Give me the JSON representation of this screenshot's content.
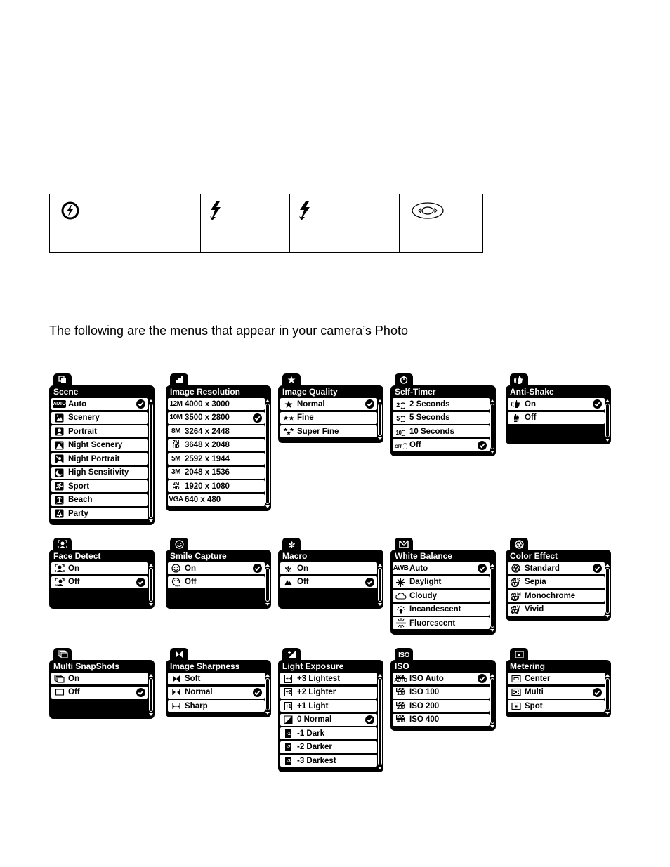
{
  "flash_table": {
    "icons": [
      "flash-off-icon",
      "flash-auto-icon",
      "flash-forced-icon",
      "left-right-nav-icon"
    ]
  },
  "intro_text": "The following are the menus that appear in your camera’s Photo",
  "menus": [
    {
      "title": "Scene",
      "tab_icon": "scene-icon",
      "items": [
        {
          "label": "Auto",
          "icon": "auto-icon",
          "selected": true
        },
        {
          "label": "Scenery",
          "icon": "scenery-icon"
        },
        {
          "label": "Portrait",
          "icon": "portrait-icon"
        },
        {
          "label": "Night Scenery",
          "icon": "night-scenery-icon"
        },
        {
          "label": "Night Portrait",
          "icon": "night-portrait-icon"
        },
        {
          "label": "High Sensitivity",
          "icon": "high-sensitivity-icon"
        },
        {
          "label": "Sport",
          "icon": "sport-icon"
        },
        {
          "label": "Beach",
          "icon": "beach-icon"
        },
        {
          "label": "Party",
          "icon": "party-icon"
        }
      ]
    },
    {
      "title": "Image Resolution",
      "tab_icon": "resolution-icon",
      "items": [
        {
          "label": "4000 x 3000",
          "icon": "12M"
        },
        {
          "label": "3500 x 2800",
          "icon": "10M",
          "selected": true
        },
        {
          "label": "3264 x 2448",
          "icon": "8M"
        },
        {
          "label": "3648 x 2048",
          "icon": "7M HD"
        },
        {
          "label": "2592 x 1944",
          "icon": "5M"
        },
        {
          "label": "2048 x 1536",
          "icon": "3M"
        },
        {
          "label": "1920 x 1080",
          "icon": "2M HD"
        },
        {
          "label": "640 x 480",
          "icon": "VGA"
        }
      ]
    },
    {
      "title": "Image Quality",
      "tab_icon": "star-icon",
      "items": [
        {
          "label": "Normal",
          "icon": "one-star-icon",
          "selected": true
        },
        {
          "label": "Fine",
          "icon": "two-star-icon"
        },
        {
          "label": "Super Fine",
          "icon": "three-star-icon"
        }
      ]
    },
    {
      "title": "Self-Timer",
      "tab_icon": "timer-icon",
      "items": [
        {
          "label": "2 Seconds",
          "icon": "timer-2-icon"
        },
        {
          "label": "5 Seconds",
          "icon": "timer-5-icon"
        },
        {
          "label": "10 Seconds",
          "icon": "timer-10-icon"
        },
        {
          "label": "Off",
          "icon": "timer-off-icon",
          "selected": true
        }
      ]
    },
    {
      "title": "Anti-Shake",
      "tab_icon": "hand-icon",
      "items": [
        {
          "label": "On",
          "icon": "anti-shake-on-icon",
          "selected": true
        },
        {
          "label": "Off",
          "icon": "anti-shake-off-icon"
        }
      ]
    },
    {
      "title": "Face Detect",
      "tab_icon": "face-icon",
      "items": [
        {
          "label": "On",
          "icon": "face-detect-on-icon"
        },
        {
          "label": "Off",
          "icon": "face-detect-off-icon",
          "selected": true
        }
      ]
    },
    {
      "title": "Smile Capture",
      "tab_icon": "smile-icon",
      "items": [
        {
          "label": "On",
          "icon": "smile-on-icon",
          "selected": true
        },
        {
          "label": "Off",
          "icon": "smile-off-icon"
        }
      ]
    },
    {
      "title": "Macro",
      "tab_icon": "flower-icon",
      "items": [
        {
          "label": "On",
          "icon": "macro-on-icon"
        },
        {
          "label": "Off",
          "icon": "mountain-icon",
          "selected": true
        }
      ]
    },
    {
      "title": "White Balance",
      "tab_icon": "white-balance-icon",
      "items": [
        {
          "label": "Auto",
          "icon": "AWB",
          "selected": true
        },
        {
          "label": "Daylight",
          "icon": "sun-icon"
        },
        {
          "label": "Cloudy",
          "icon": "cloud-icon"
        },
        {
          "label": "Incandescent",
          "icon": "bulb-icon"
        },
        {
          "label": "Fluorescent",
          "icon": "fluorescent-icon"
        }
      ]
    },
    {
      "title": "Color Effect",
      "tab_icon": "color-effect-icon",
      "items": [
        {
          "label": "Standard",
          "icon": "color-standard-icon",
          "selected": true
        },
        {
          "label": "Sepia",
          "icon": "color-sepia-icon"
        },
        {
          "label": "Monochrome",
          "icon": "color-mono-icon"
        },
        {
          "label": "Vivid",
          "icon": "color-vivid-icon"
        }
      ]
    },
    {
      "title": "Multi SnapShots",
      "tab_icon": "multi-snap-icon",
      "items": [
        {
          "label": "On",
          "icon": "multi-snap-on-icon"
        },
        {
          "label": "Off",
          "icon": "single-frame-icon",
          "selected": true
        }
      ]
    },
    {
      "title": "Image Sharpness",
      "tab_icon": "sharpness-icon",
      "items": [
        {
          "label": "Soft",
          "icon": "sharpness-soft-icon"
        },
        {
          "label": "Normal",
          "icon": "sharpness-normal-icon",
          "selected": true
        },
        {
          "label": "Sharp",
          "icon": "sharpness-sharp-icon"
        }
      ]
    },
    {
      "title": "Light Exposure",
      "tab_icon": "exposure-icon",
      "items": [
        {
          "label": "+3 Lightest",
          "icon": "+3"
        },
        {
          "label": "+2 Lighter",
          "icon": "+2"
        },
        {
          "label": "+1 Light",
          "icon": "+1"
        },
        {
          "label": "0 Normal",
          "icon": "0",
          "selected": true
        },
        {
          "label": "-1 Dark",
          "icon": "-1"
        },
        {
          "label": "-2 Darker",
          "icon": "-2"
        },
        {
          "label": "-3 Darkest",
          "icon": "-3"
        }
      ]
    },
    {
      "title": "ISO",
      "tab_icon": "ISO",
      "items": [
        {
          "label": "ISO Auto",
          "icon": "AUTO",
          "selected": true
        },
        {
          "label": "ISO 100",
          "icon": "100"
        },
        {
          "label": "ISO 200",
          "icon": "200"
        },
        {
          "label": "ISO 400",
          "icon": "400"
        }
      ]
    },
    {
      "title": "Metering",
      "tab_icon": "metering-icon",
      "items": [
        {
          "label": "Center",
          "icon": "metering-center-icon"
        },
        {
          "label": "Multi",
          "icon": "metering-multi-icon",
          "selected": true
        },
        {
          "label": "Spot",
          "icon": "metering-spot-icon"
        }
      ]
    }
  ]
}
